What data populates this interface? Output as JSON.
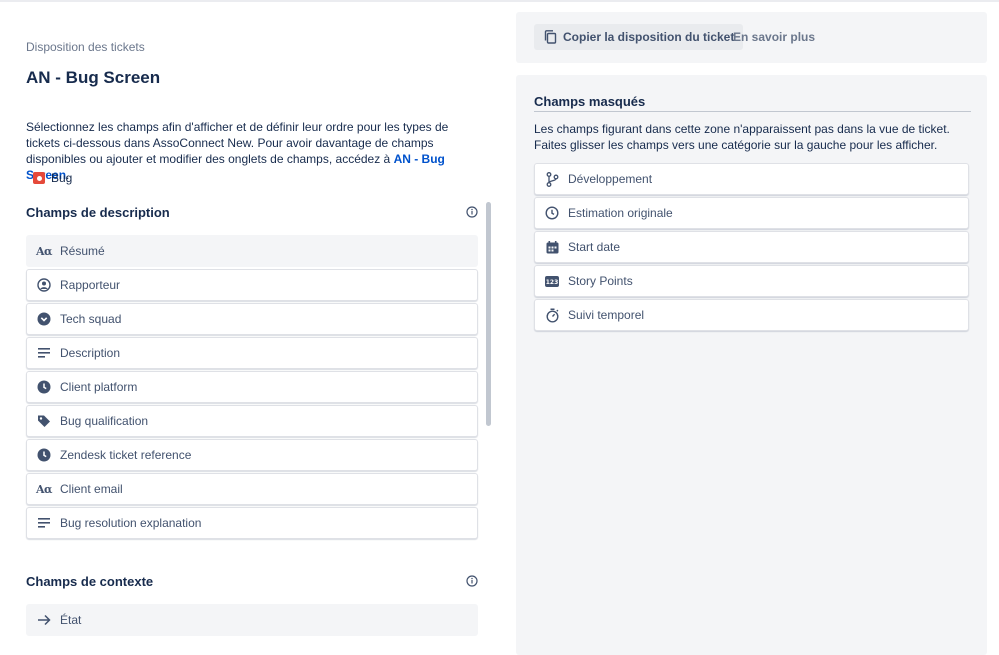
{
  "left": {
    "breadcrumb": "Disposition des tickets",
    "title": "AN - Bug Screen",
    "intro_text": "Sélectionnez les champs afin d'afficher et de définir leur ordre pour les types de tickets ci-dessous dans AssoConnect New. Pour avoir davantage de champs disponibles ou ajouter et modifier des onglets de champs, accédez à ",
    "intro_link": "AN - Bug Screen",
    "intro_end": ".",
    "issue_type": "Bug",
    "description_section": {
      "title": "Champs de description",
      "fields": [
        {
          "label": "Résumé",
          "icon": "text-icon"
        },
        {
          "label": "Rapporteur",
          "icon": "user-icon"
        },
        {
          "label": "Tech squad",
          "icon": "dropdown-icon"
        },
        {
          "label": "Description",
          "icon": "paragraph-icon"
        },
        {
          "label": "Client platform",
          "icon": "clock-icon"
        },
        {
          "label": "Bug qualification",
          "icon": "label-icon"
        },
        {
          "label": "Zendesk ticket reference",
          "icon": "clock-icon"
        },
        {
          "label": "Client email",
          "icon": "text-icon"
        },
        {
          "label": "Bug resolution explanation",
          "icon": "paragraph-icon"
        }
      ]
    },
    "context_section": {
      "title": "Champs de contexte",
      "fields": [
        {
          "label": "État",
          "icon": "arrow-right-icon"
        }
      ]
    }
  },
  "toolbar": {
    "copy_label": "Copier la disposition du ticket",
    "learn_more": "En savoir plus"
  },
  "hidden": {
    "title": "Champs masqués",
    "description": "Les champs figurant dans cette zone n'apparaissent pas dans la vue de ticket. Faites glisser les champs vers une catégorie sur la gauche pour les afficher.",
    "fields": [
      {
        "label": "Développement",
        "icon": "branch-icon"
      },
      {
        "label": "Estimation originale",
        "icon": "clock-outline-icon"
      },
      {
        "label": "Start date",
        "icon": "calendar-icon"
      },
      {
        "label": "Story Points",
        "icon": "number-icon"
      },
      {
        "label": "Suivi temporel",
        "icon": "stopwatch-icon"
      }
    ]
  },
  "colors": {
    "text": "#172b4d",
    "subtle": "#6b778c",
    "link": "#0052cc",
    "bug": "#e5493a",
    "panel": "#f4f5f7"
  }
}
